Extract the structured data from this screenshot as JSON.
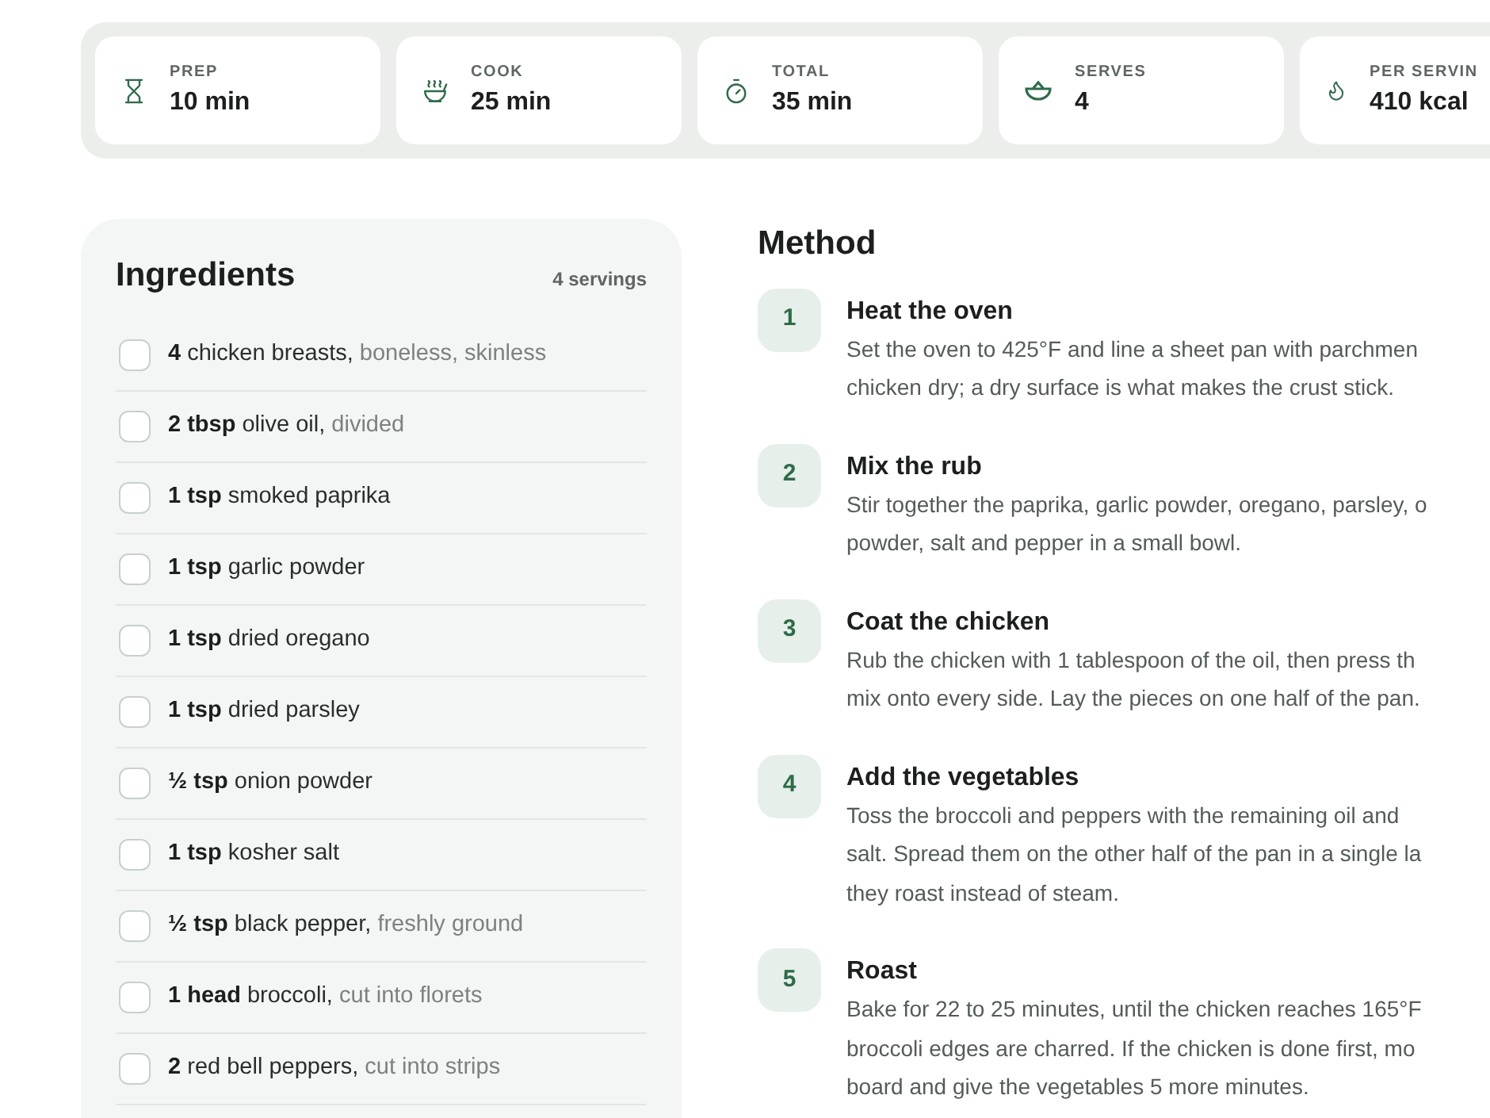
{
  "stats": [
    {
      "kind": "prep",
      "label": "PREP",
      "value": "10 min"
    },
    {
      "kind": "cook",
      "label": "COOK",
      "value": "25 min"
    },
    {
      "kind": "total",
      "label": "TOTAL",
      "value": "35 min"
    },
    {
      "kind": "serves",
      "label": "SERVES",
      "value": "4"
    },
    {
      "kind": "energy",
      "label": "PER SERVIN",
      "value": "410 kcal"
    }
  ],
  "ingredients": {
    "title": "Ingredients",
    "servings": "4 servings",
    "items": [
      {
        "amount": "4",
        "name": "chicken breasts,",
        "note": "boneless, skinless",
        "checked": false
      },
      {
        "amount": "2 tbsp",
        "name": "olive oil,",
        "note": "divided",
        "checked": false
      },
      {
        "amount": "1 tsp",
        "name": "smoked paprika",
        "checked": false
      },
      {
        "amount": "1 tsp",
        "name": "garlic powder",
        "checked": false
      },
      {
        "amount": "1 tsp",
        "name": "dried oregano",
        "checked": false
      },
      {
        "amount": "1 tsp",
        "name": "dried parsley",
        "checked": false
      },
      {
        "amount": "½ tsp",
        "name": "onion powder",
        "checked": false
      },
      {
        "amount": "1 tsp",
        "name": "kosher salt",
        "checked": false
      },
      {
        "amount": "½ tsp",
        "name": "black pepper,",
        "note": "freshly ground",
        "checked": false
      },
      {
        "amount": "1 head",
        "name": "broccoli,",
        "note": "cut into florets",
        "checked": false
      },
      {
        "amount": "2",
        "name": "red bell peppers,",
        "note": "cut into strips",
        "checked": false
      }
    ]
  },
  "method": {
    "title": "Method",
    "steps": [
      {
        "number": "1",
        "title": "Heat the oven",
        "lines": [
          "Set the oven to 425°F and line a sheet pan with parchmen",
          "chicken dry; a dry surface is what makes the crust stick."
        ]
      },
      {
        "number": "2",
        "title": "Mix the rub",
        "lines": [
          "Stir together the paprika, garlic powder, oregano, parsley, o",
          "powder, salt and pepper in a small bowl."
        ]
      },
      {
        "number": "3",
        "title": "Coat the chicken",
        "lines": [
          "Rub the chicken with 1 tablespoon of the oil, then press th",
          "mix onto every side. Lay the pieces on one half of the pan."
        ]
      },
      {
        "number": "4",
        "title": "Add the vegetables",
        "lines": [
          "Toss the broccoli and peppers with the remaining oil and",
          "salt. Spread them on the other half of the pan in a single la",
          "they roast instead of steam."
        ]
      },
      {
        "number": "5",
        "title": "Roast",
        "lines": [
          "Bake for 22 to 25 minutes, until the chicken reaches 165°F",
          "broccoli edges are charred. If the chicken is done first, mo",
          "board and give the vegetables 5 more minutes."
        ]
      }
    ]
  }
}
